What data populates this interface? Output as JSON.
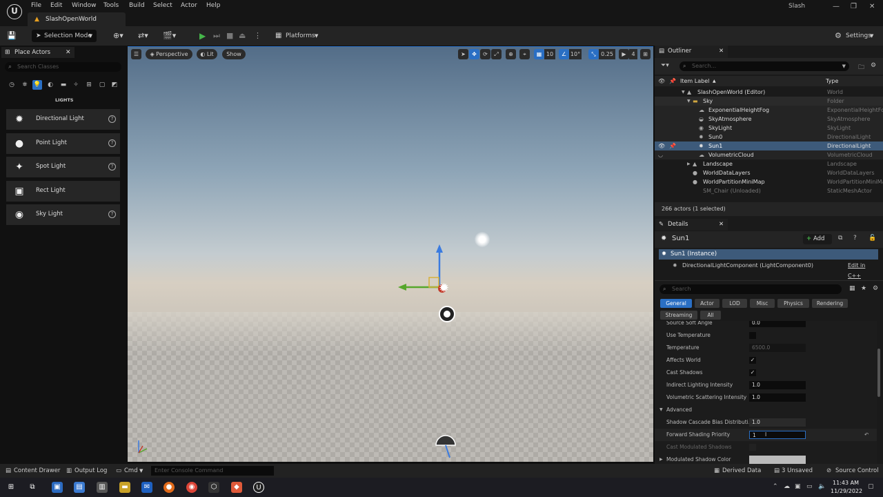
{
  "menu": {
    "items": [
      "File",
      "Edit",
      "Window",
      "Tools",
      "Build",
      "Select",
      "Actor",
      "Help"
    ]
  },
  "app": {
    "logo": "U",
    "doc_tab": "SlashOpenWorld",
    "project": "Slash"
  },
  "toolbar": {
    "selection_mode": "Selection Mode",
    "platforms": "Platforms",
    "settings": "Settings"
  },
  "place_actors": {
    "tab": "Place Actors",
    "search_placeholder": "Search Classes",
    "category_title": "LIGHTS",
    "items": [
      {
        "label": "Directional Light",
        "icon": "directional-light-icon"
      },
      {
        "label": "Point Light",
        "icon": "point-light-icon"
      },
      {
        "label": "Spot Light",
        "icon": "spot-light-icon"
      },
      {
        "label": "Rect Light",
        "icon": "rect-light-icon"
      },
      {
        "label": "Sky Light",
        "icon": "sky-light-icon"
      }
    ]
  },
  "viewport": {
    "perspective": "Perspective",
    "lit": "Lit",
    "show": "Show",
    "grid_snap": "10",
    "rot_snap": "10°",
    "scale_snap": "0.25",
    "camera_speed": "4"
  },
  "outliner": {
    "tab": "Outliner",
    "search_placeholder": "Search...",
    "col_label": "Item Label",
    "col_type": "Type",
    "rows": [
      {
        "name": "SlashOpenWorld (Editor)",
        "type": "World"
      },
      {
        "name": "Sky",
        "type": "Folder"
      },
      {
        "name": "ExponentialHeightFog",
        "type": "ExponentialHeightFog"
      },
      {
        "name": "SkyAtmosphere",
        "type": "SkyAtmosphere"
      },
      {
        "name": "SkyLight",
        "type": "SkyLight"
      },
      {
        "name": "Sun0",
        "type": "DirectionalLight"
      },
      {
        "name": "Sun1",
        "type": "DirectionalLight"
      },
      {
        "name": "VolumetricCloud",
        "type": "VolumetricCloud"
      },
      {
        "name": "Landscape",
        "type": "Landscape"
      },
      {
        "name": "WorldDataLayers",
        "type": "WorldDataLayers"
      },
      {
        "name": "WorldPartitionMiniMap",
        "type": "WorldPartitionMiniMap"
      },
      {
        "name": "SM_Chair (Unloaded)",
        "type": "StaticMeshActor"
      }
    ],
    "count": "266 actors (1 selected)"
  },
  "details": {
    "tab": "Details",
    "actor_name": "Sun1",
    "add": "Add",
    "instance": "Sun1 (Instance)",
    "component": "DirectionalLightComponent (LightComponent0)",
    "edit_cpp": "Edit in C++",
    "search_placeholder": "Search",
    "filters": [
      "General",
      "Actor",
      "LOD",
      "Misc",
      "Physics",
      "Rendering",
      "Streaming",
      "All"
    ],
    "props": {
      "source_soft_angle": {
        "label": "Source Soft Angle",
        "value": "0.0"
      },
      "use_temperature": {
        "label": "Use Temperature"
      },
      "temperature": {
        "label": "Temperature",
        "value": "6500.0"
      },
      "affects_world": {
        "label": "Affects World",
        "check": "✓"
      },
      "cast_shadows": {
        "label": "Cast Shadows",
        "check": "✓"
      },
      "indirect": {
        "label": "Indirect Lighting Intensity",
        "value": "1.0"
      },
      "volumetric": {
        "label": "Volumetric Scattering Intensity",
        "value": "1.0"
      },
      "advanced": {
        "label": "Advanced"
      },
      "cascade": {
        "label": "Shadow Cascade Bias Distributi...",
        "value": "1.0"
      },
      "forward": {
        "label": "Forward Shading Priority",
        "value": "1"
      },
      "modulated": {
        "label": "Cast Modulated Shadows"
      },
      "mod_color": {
        "label": "Modulated Shadow Color"
      }
    }
  },
  "statusbar": {
    "content_drawer": "Content Drawer",
    "output_log": "Output Log",
    "cmd": "Cmd",
    "console_placeholder": "Enter Console Command",
    "derived_data": "Derived Data",
    "unsaved": "3 Unsaved",
    "source_control": "Source Control"
  },
  "taskbar": {
    "time": "11:43 AM",
    "date": "11/29/2022"
  },
  "colors": {
    "accent": "#2a6fc4",
    "selection": "#3d5a7a",
    "play": "#45b54a"
  }
}
